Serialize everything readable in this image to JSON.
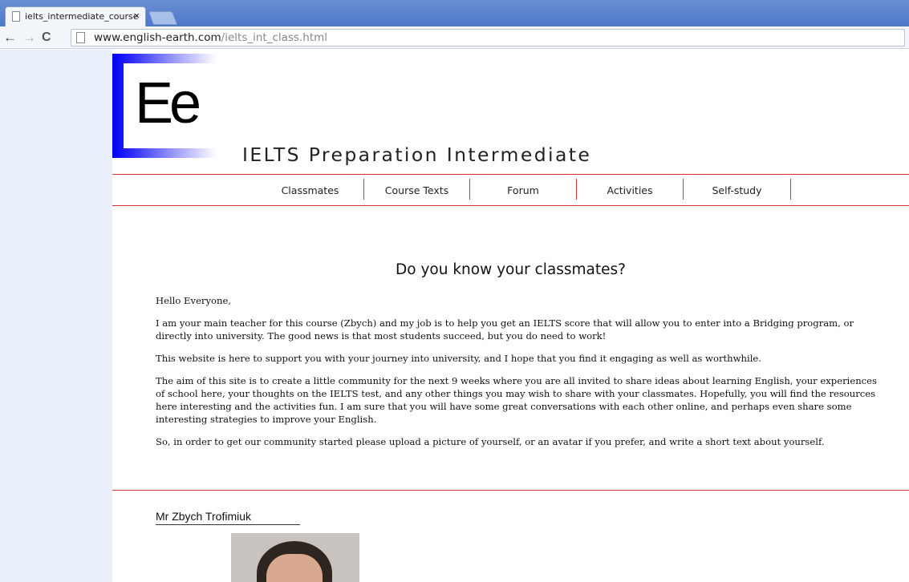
{
  "browser": {
    "tab_title": "ielts_intermediate_course",
    "tab_close": "×",
    "url_host": "www.english-earth.com",
    "url_path": "/ielts_int_class.html"
  },
  "site": {
    "logo_text": "Ee",
    "title": "IELTS Preparation Intermediate"
  },
  "nav": {
    "items": [
      "Classmates",
      "Course Texts",
      "Forum",
      "Activities",
      "Self-study"
    ]
  },
  "main": {
    "heading": "Do you know your classmates?",
    "paragraphs": [
      "Hello Everyone,",
      "I am your main teacher for this course (Zbych) and my job is to help you get an IELTS score that will allow you to enter into a Bridging program, or directly into university. The good news is that most students succeed, but you do need to work!",
      "This website is here to support you with your journey into university, and I hope that you find it engaging as well as worthwhile.",
      "The aim of this site is to create a little community for the next 9 weeks where you are all invited to share ideas about learning English, your experiences of school here, your thoughts on the IELTS test, and any other things you may wish to share with your classmates. Hopefully, you will find the resources here interesting and the activities fun. I am sure that you will have some great conversations with each other online, and perhaps even share some interesting strategies to improve your English.",
      "So, in order to get our community started please upload a picture of yourself, or an avatar if you prefer, and write a short text about yourself."
    ]
  },
  "teacher": {
    "name": "Mr Zbych Trofimiuk"
  },
  "colors": {
    "accent_rule": "#dd3333",
    "logo_blue": "#0000ee",
    "chrome_blue": "#4c77c8",
    "left_panel": "#e9f0fb"
  }
}
